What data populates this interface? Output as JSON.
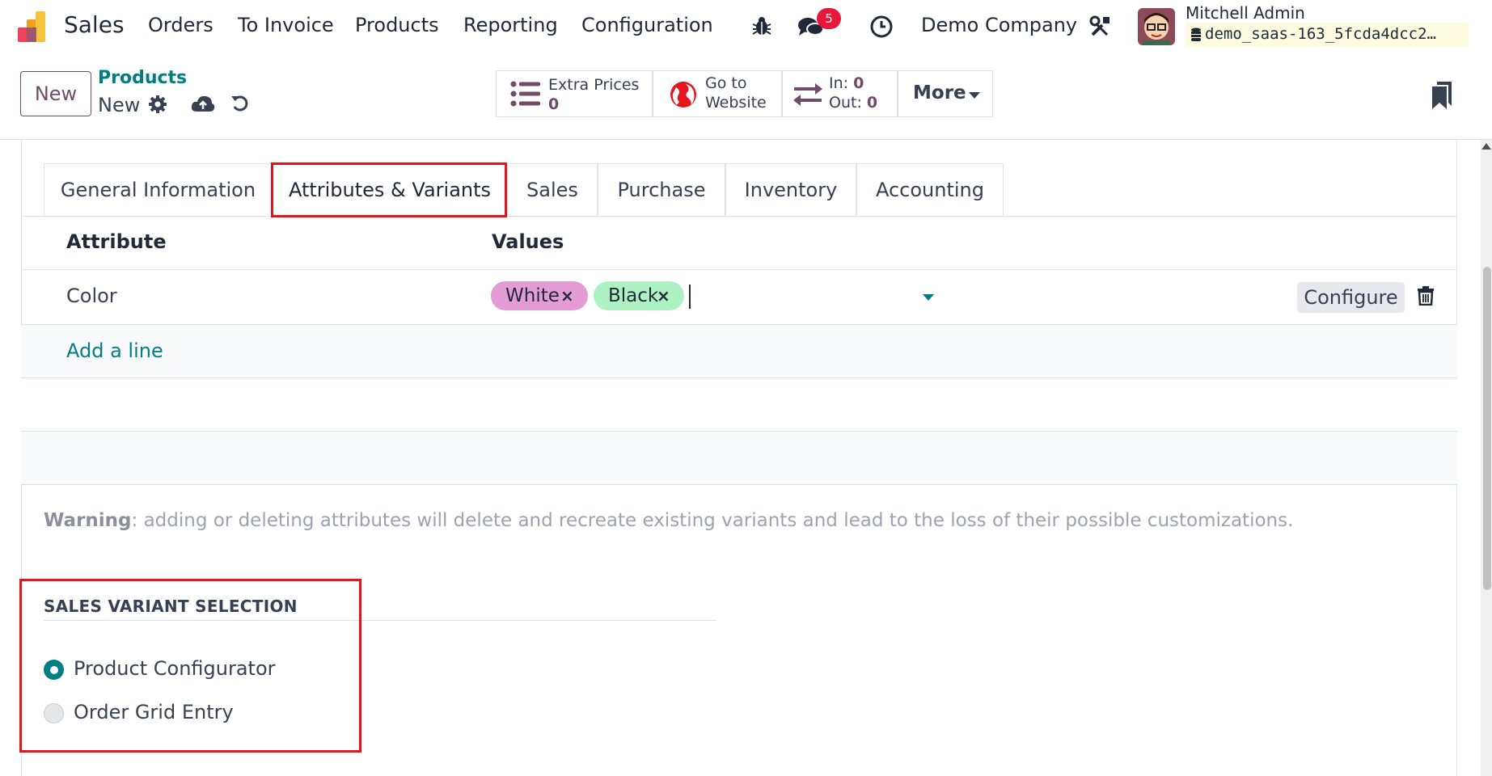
{
  "navbar": {
    "app_name": "Sales",
    "menu": [
      "Orders",
      "To Invoice",
      "Products",
      "Reporting",
      "Configuration"
    ],
    "messages_count": "5",
    "company": "Demo Company",
    "user_name": "Mitchell Admin",
    "database": "demo_saas-163_5fcda4dcc2…"
  },
  "control_panel": {
    "new_button": "New",
    "breadcrumb_parent": "Products",
    "breadcrumb_current": "New",
    "smart_buttons": {
      "extra_prices_label": "Extra Prices",
      "extra_prices_value": "0",
      "website_line1": "Go to",
      "website_line2": "Website",
      "in_label": "In:",
      "in_value": "0",
      "out_label": "Out:",
      "out_value": "0",
      "more_label": "More"
    }
  },
  "tabs": [
    {
      "label": "General Information",
      "active": false
    },
    {
      "label": "Attributes & Variants",
      "active": true
    },
    {
      "label": "Sales",
      "active": false
    },
    {
      "label": "Purchase",
      "active": false
    },
    {
      "label": "Inventory",
      "active": false
    },
    {
      "label": "Accounting",
      "active": false
    }
  ],
  "attributes_table": {
    "headers": {
      "attribute": "Attribute",
      "values": "Values"
    },
    "rows": [
      {
        "attribute": "Color",
        "values": [
          {
            "label": "White",
            "color": "#e49cd6"
          },
          {
            "label": "Black",
            "color": "#aef2c4"
          }
        ]
      }
    ],
    "configure_label": "Configure",
    "add_line": "Add a line"
  },
  "warning": {
    "prefix": "Warning",
    "text": ": adding or deleting attributes will delete and recreate existing variants and lead to the loss of their possible customizations."
  },
  "sales_variant_selection": {
    "title": "SALES VARIANT SELECTION",
    "options": [
      {
        "label": "Product Configurator",
        "selected": true
      },
      {
        "label": "Order Grid Entry",
        "selected": false
      }
    ]
  },
  "colors": {
    "brand": "#714b67",
    "teal": "#017e84",
    "highlight_red": "#e3161d",
    "badge_red": "#e8173c"
  }
}
